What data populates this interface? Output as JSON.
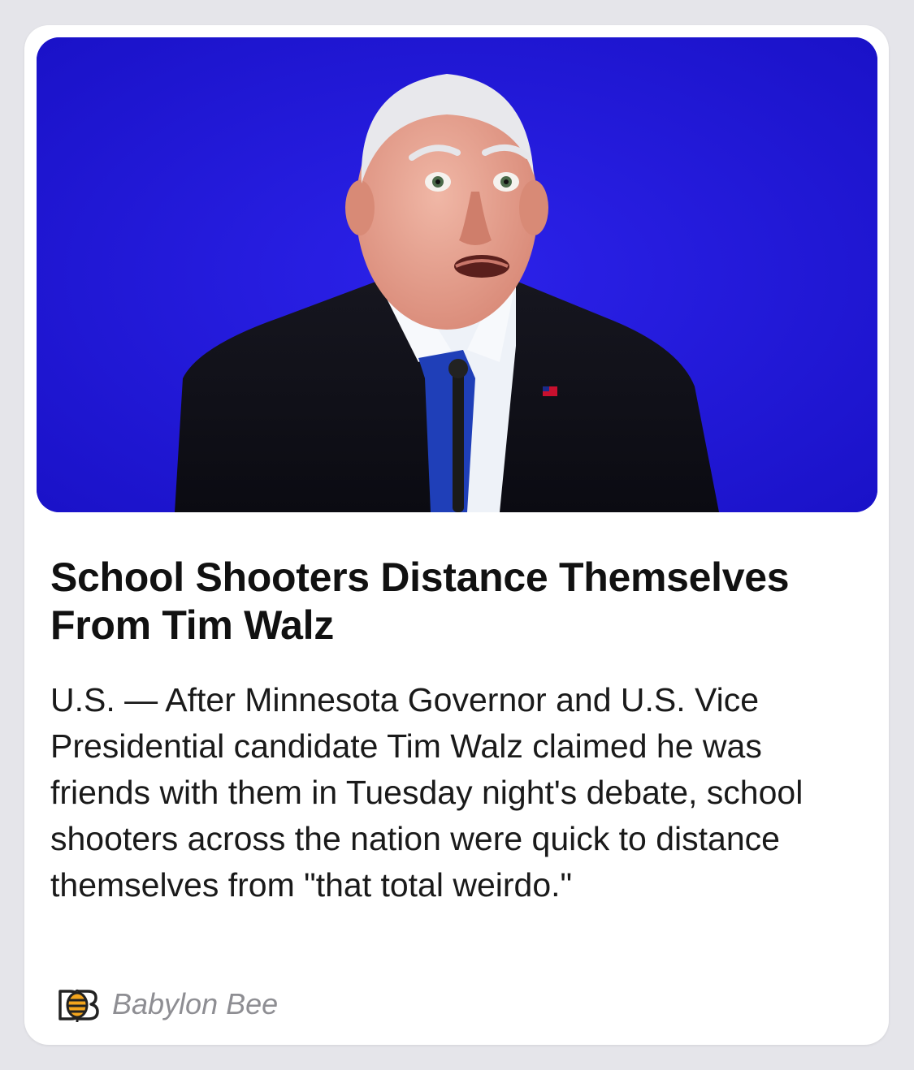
{
  "article": {
    "headline": "School Shooters Distance Themselves From Tim Walz",
    "summary": "U.S. — After Minnesota Governor and U.S. Vice Presidential candidate Tim Walz claimed he was friends with them in Tuesday night's debate, school shooters across the nation were quick to distance themselves from \"that total weirdo.\"",
    "source": {
      "name": "Babylon Bee",
      "icon": "babylon-bee-logo"
    }
  },
  "colors": {
    "card_background": "#ffffff",
    "page_background": "#e5e5ea",
    "photo_background": "#2418de",
    "source_text": "#8e8e93"
  }
}
